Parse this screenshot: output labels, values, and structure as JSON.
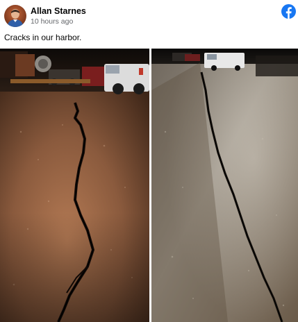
{
  "post": {
    "author": "Allan Starnes",
    "timestamp": "10 hours ago",
    "caption": "Cracks in our harbor."
  },
  "icons": {
    "logo": "facebook-logo-icon",
    "avatar": "user-avatar"
  },
  "colors": {
    "brand": "#1877f2",
    "secondary_text": "#65676b"
  },
  "photos": [
    {
      "description_name": "cracked-ground-photo-left"
    },
    {
      "description_name": "cracked-ground-photo-right"
    }
  ]
}
